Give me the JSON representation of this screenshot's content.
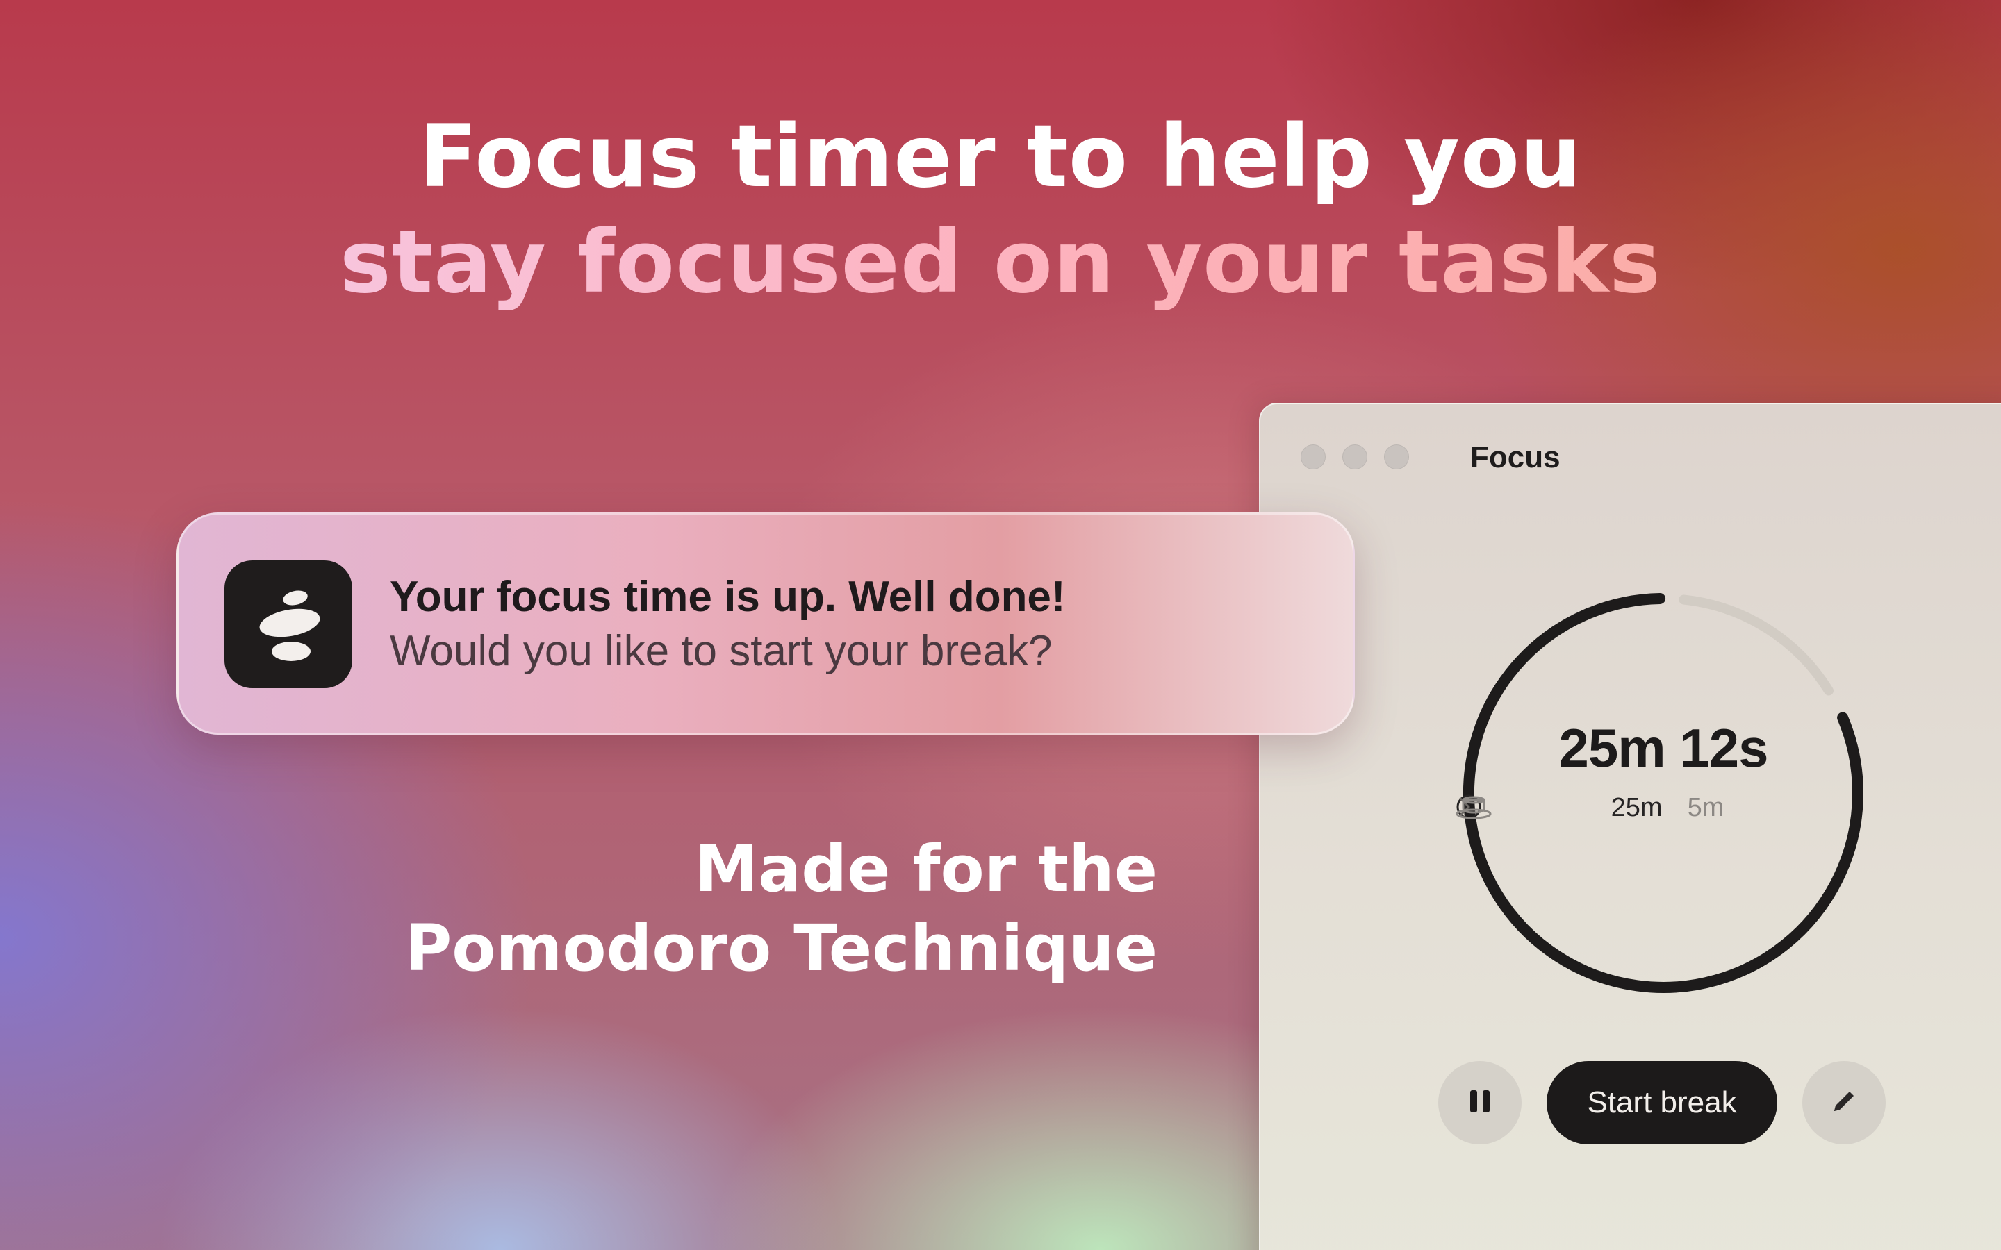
{
  "headline": {
    "line1": "Focus timer to help you",
    "line2": "stay focused on your tasks"
  },
  "subheadline": {
    "line1": "Made for the",
    "line2": "Pomodoro Technique"
  },
  "notification": {
    "app_icon": "stacked-stones-icon",
    "title": "Your focus time is up. Well done!",
    "body": "Would you like to start your break?"
  },
  "window": {
    "title": "Focus",
    "timer": {
      "elapsed": "25m 12s",
      "focus_duration": "25m",
      "break_duration": "5m",
      "focus_icon": "clock-icon",
      "separator_icon": "chevron-right-icon",
      "break_icon": "coffee-cup-icon",
      "focus_arc_fraction": 0.83
    },
    "controls": {
      "pause_icon": "pause-icon",
      "primary_label": "Start break",
      "edit_icon": "pencil-icon"
    }
  },
  "colors": {
    "ring_active": "#1d1b1b",
    "ring_track": "#d2ccc4",
    "button_dark": "#1c1a1a"
  }
}
